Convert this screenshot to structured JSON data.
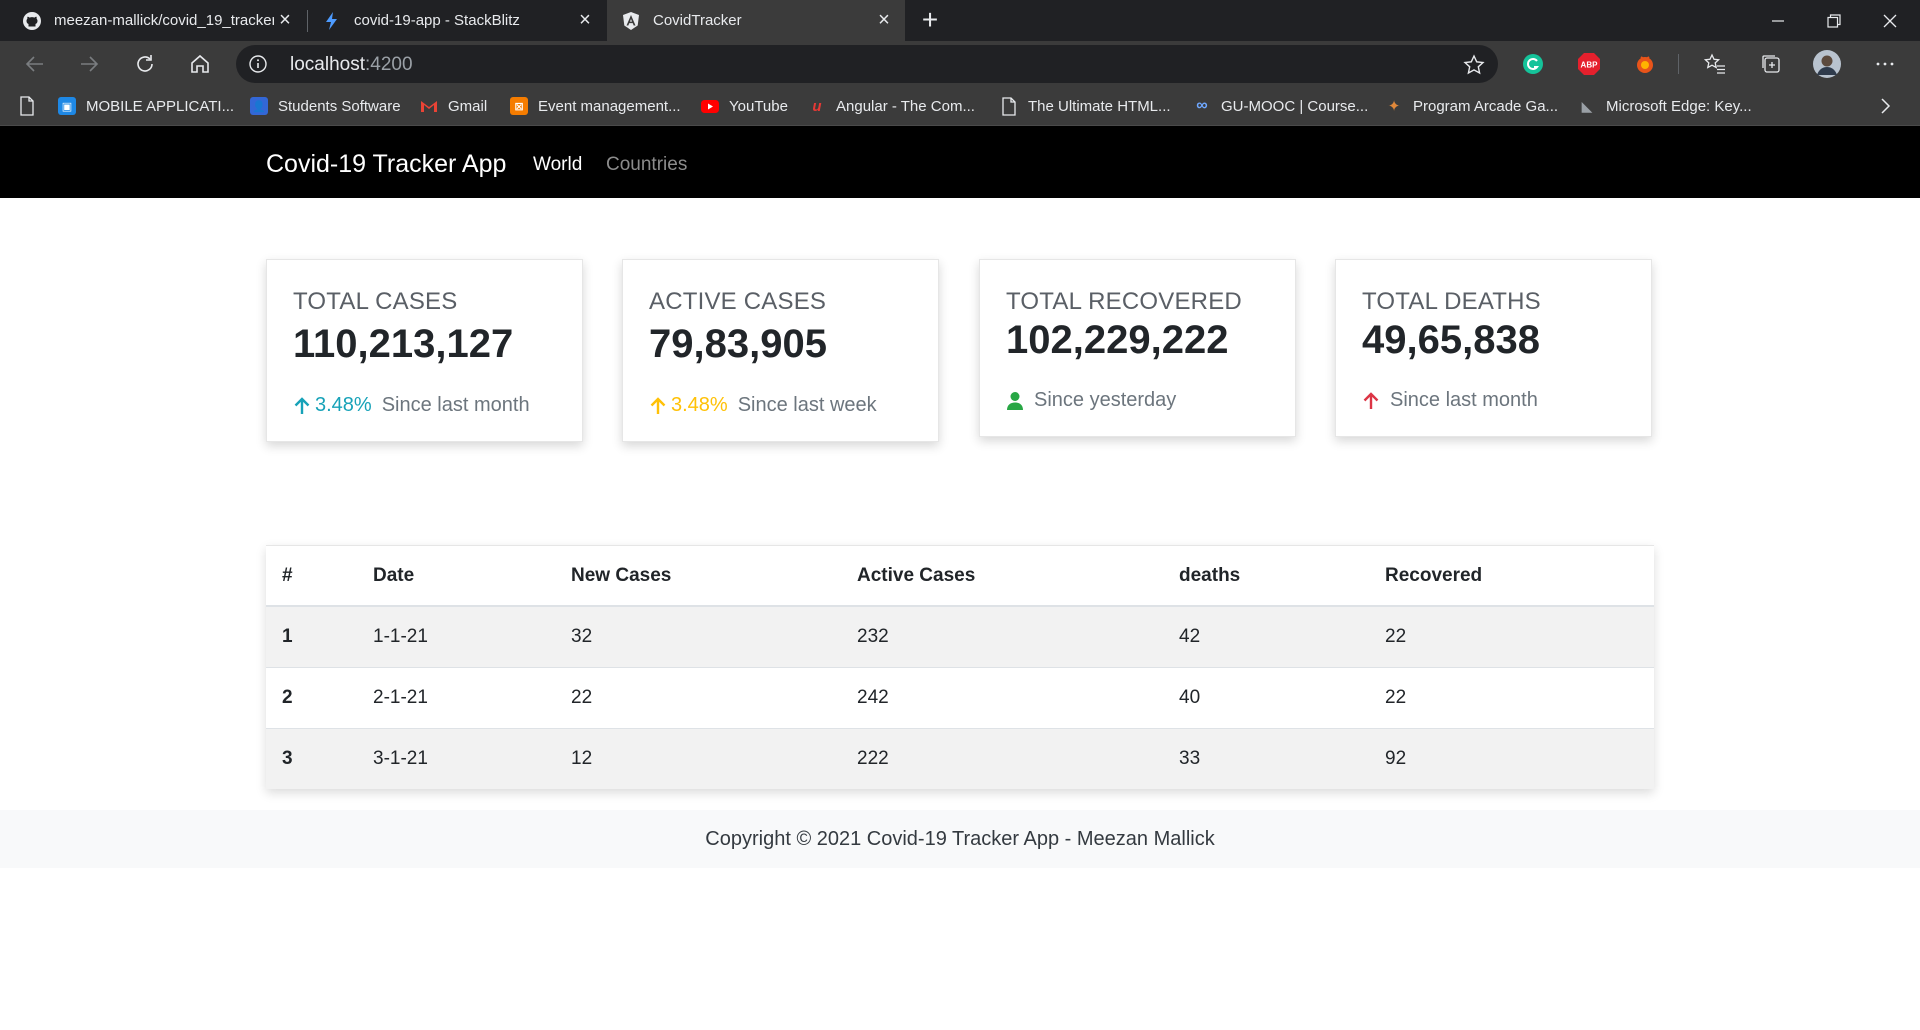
{
  "browser": {
    "tabs": [
      {
        "title": "meezan-mallick/covid_19_tracker",
        "icon": "github-icon"
      },
      {
        "title": "covid-19-app - StackBlitz",
        "icon": "stackblitz-icon"
      },
      {
        "title": "CovidTracker",
        "icon": "angular-icon"
      }
    ],
    "url_host": "localhost",
    "url_port": ":4200",
    "bookmarks": [
      "MOBILE APPLICATI...",
      "Students Software",
      "Gmail",
      "Event management...",
      "YouTube",
      "Angular - The Com...",
      "The Ultimate HTML...",
      "GU-MOOC | Course...",
      "Program Arcade Ga...",
      "Microsoft Edge: Key..."
    ],
    "extensions": {
      "abp_label": "ABP"
    }
  },
  "app": {
    "brand": "Covid-19 Tracker App",
    "nav": {
      "world": "World",
      "countries": "Countries"
    }
  },
  "cards": [
    {
      "title": "TOTAL CASES",
      "value": "110,213,127",
      "percent": "3.48%",
      "since": "Since last month",
      "color": "#17a2b8",
      "icon": "arrow-up-icon"
    },
    {
      "title": "ACTIVE CASES",
      "value": "79,83,905",
      "percent": "3.48%",
      "since": "Since last week",
      "color": "#ffc107",
      "icon": "arrow-up-icon"
    },
    {
      "title": "TOTAL RECOVERED",
      "value": "102,229,222",
      "percent": "",
      "since": "Since yesterday",
      "color": "#28a745",
      "icon": "user-icon"
    },
    {
      "title": "TOTAL DEATHS",
      "value": "49,65,838",
      "percent": "",
      "since": "Since last month",
      "color": "#dc3545",
      "icon": "arrow-up-icon"
    }
  ],
  "table": {
    "headers": [
      "#",
      "Date",
      "New Cases",
      "Active Cases",
      "deaths",
      "Recovered"
    ],
    "rows": [
      [
        "1",
        "1-1-21",
        "32",
        "232",
        "42",
        "22"
      ],
      [
        "2",
        "2-1-21",
        "22",
        "242",
        "40",
        "22"
      ],
      [
        "3",
        "3-1-21",
        "12",
        "222",
        "33",
        "92"
      ]
    ]
  },
  "footer": {
    "copyright": "Copyright © 2021 Covid-19 Tracker App - Meezan Mallick"
  }
}
